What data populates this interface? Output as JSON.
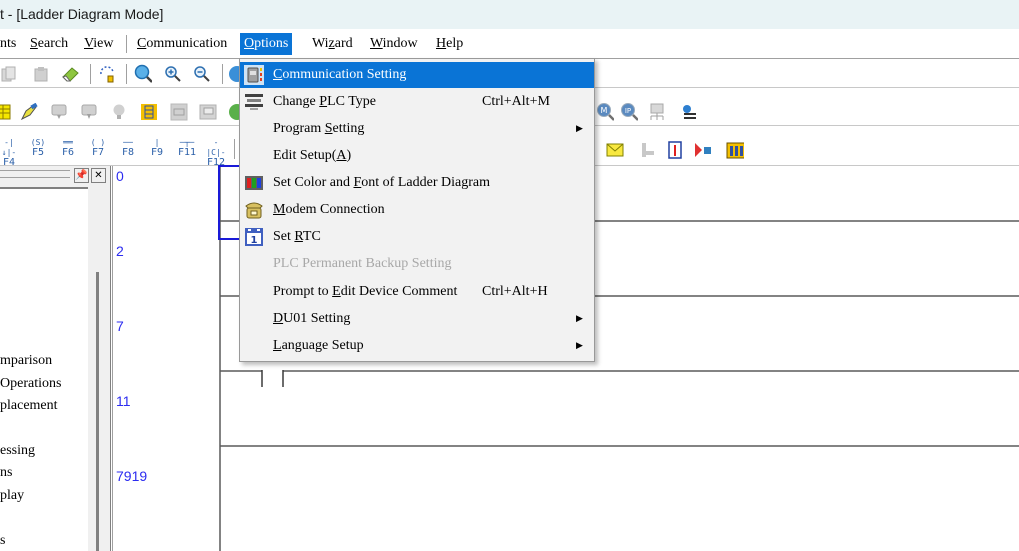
{
  "window": {
    "title": "t - [Ladder Diagram Mode]"
  },
  "menubar": {
    "items": [
      {
        "label": "nts",
        "underline_index": -1
      },
      {
        "label": "Search",
        "underline_index": 0
      },
      {
        "label": "View",
        "underline_index": 0
      },
      {
        "label": "Communication",
        "underline_index": 0
      },
      {
        "label": "Options",
        "underline_index": 0,
        "active": true
      },
      {
        "label": "Wizard",
        "underline_index": 2
      },
      {
        "label": "Window",
        "underline_index": 0
      },
      {
        "label": "Help",
        "underline_index": 0
      }
    ]
  },
  "toolbar1": {
    "icons": [
      "copy-icon",
      "paste-icon",
      "eraser-icon",
      "undo-redo-icon",
      "search-icon",
      "zoom-in-icon",
      "zoom-out-icon",
      "globe-icon"
    ]
  },
  "toolbar2": {
    "icons": [
      "grid-icon",
      "pen-icon",
      "monitor-up-icon",
      "monitor-down-icon",
      "bulb-icon",
      "device-map-icon",
      "relay-icon",
      "print-icon",
      "globe-green-icon"
    ],
    "right_icons": [
      "modbus-search-icon",
      "ip-search-icon",
      "network-icon",
      "settings-list-icon"
    ]
  },
  "toolbar3": {
    "fkeys": [
      {
        "symbol": "-|↓|-",
        "label": "F4"
      },
      {
        "symbol": "(S)",
        "label": "F5"
      },
      {
        "symbol": "══",
        "label": "F6"
      },
      {
        "symbol": "( )",
        "label": "F7"
      },
      {
        "symbol": "──",
        "label": "F8"
      },
      {
        "symbol": "|",
        "label": "F9"
      },
      {
        "symbol": "─┬─",
        "label": "F11"
      },
      {
        "symbol": "-|C|-",
        "label": "F12"
      }
    ],
    "right_icons": [
      "mail-icon",
      "axis-icon",
      "thermometer-icon",
      "signal-block-icon",
      "module-icon"
    ]
  },
  "left_panel": {
    "tree_items": [
      "mparison",
      "Operations",
      "placement",
      "",
      "essing",
      "ns",
      "play",
      "",
      "s"
    ]
  },
  "ladder": {
    "line_numbers": [
      "0",
      "2",
      "7",
      "11",
      "7919"
    ]
  },
  "options_menu": {
    "items": [
      {
        "label_pre": "",
        "label_u": "C",
        "label_post": "ommunication Setting",
        "shortcut": "",
        "submenu": false,
        "icon": "communication-setting-icon",
        "highlighted": true,
        "disabled": false
      },
      {
        "label_pre": "Change ",
        "label_u": "P",
        "label_post": "LC Type",
        "shortcut": "Ctrl+Alt+M",
        "submenu": false,
        "icon": "change-plc-type-icon",
        "highlighted": false,
        "disabled": false
      },
      {
        "label_pre": "Program ",
        "label_u": "S",
        "label_post": "etting",
        "shortcut": "",
        "submenu": true,
        "icon": "",
        "highlighted": false,
        "disabled": false
      },
      {
        "label_pre": "Edit Setup(",
        "label_u": "A",
        "label_post": ")",
        "shortcut": "",
        "submenu": false,
        "icon": "",
        "highlighted": false,
        "disabled": false
      },
      {
        "label_pre": "Set Color and ",
        "label_u": "F",
        "label_post": "ont of Ladder Diagram",
        "shortcut": "",
        "submenu": false,
        "icon": "color-palette-icon",
        "highlighted": false,
        "disabled": false
      },
      {
        "label_pre": "",
        "label_u": "M",
        "label_post": "odem Connection",
        "shortcut": "",
        "submenu": false,
        "icon": "telephone-icon",
        "highlighted": false,
        "disabled": false
      },
      {
        "label_pre": "Set ",
        "label_u": "R",
        "label_post": "TC",
        "shortcut": "",
        "submenu": false,
        "icon": "calendar-icon",
        "highlighted": false,
        "disabled": false
      },
      {
        "label_pre": "PLC Permanent Backup Setting",
        "label_u": "",
        "label_post": "",
        "shortcut": "",
        "submenu": false,
        "icon": "",
        "highlighted": false,
        "disabled": true
      },
      {
        "label_pre": "Prompt to ",
        "label_u": "E",
        "label_post": "dit Device Comment",
        "shortcut": "Ctrl+Alt+H",
        "submenu": false,
        "icon": "",
        "highlighted": false,
        "disabled": false
      },
      {
        "label_pre": "",
        "label_u": "D",
        "label_post": "U01 Setting",
        "shortcut": "",
        "submenu": true,
        "icon": "",
        "highlighted": false,
        "disabled": false
      },
      {
        "label_pre": "",
        "label_u": "L",
        "label_post": "anguage Setup",
        "shortcut": "",
        "submenu": true,
        "icon": "",
        "highlighted": false,
        "disabled": false
      }
    ],
    "submenu_arrow": "▶"
  },
  "colors": {
    "accent": "#0a74d6",
    "line_number": "#2c2cf0",
    "cursor_box": "#1a1ad8",
    "rung": "#5a5a5a",
    "disabled_text": "#a8a8a8"
  }
}
